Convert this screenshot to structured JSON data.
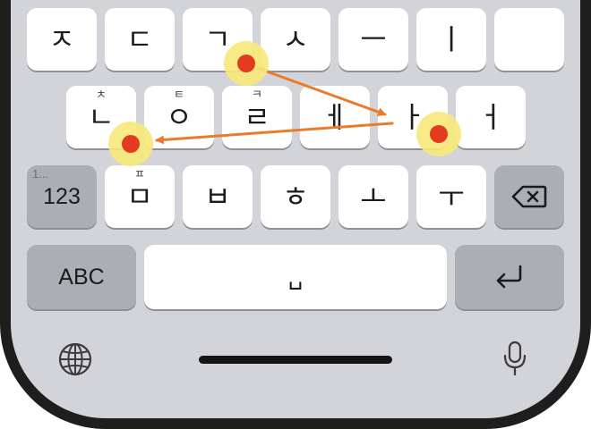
{
  "keyboard": {
    "row1": [
      {
        "char": "ㅈ"
      },
      {
        "char": "ㄷ"
      },
      {
        "char": "ㄱ"
      },
      {
        "char": "ㅅ"
      },
      {
        "char": "ㅡ"
      },
      {
        "char": "ㅣ"
      },
      {
        "char": ""
      }
    ],
    "row2": [
      {
        "char": "ㄴ",
        "sub": "ㅊ"
      },
      {
        "char": "ㅇ",
        "sub": "ㅌ"
      },
      {
        "char": "ㄹ",
        "sub": "ㅋ"
      },
      {
        "char": "ㅔ"
      },
      {
        "char": "ㅏ"
      },
      {
        "char": "ㅓ"
      }
    ],
    "row3": [
      {
        "char": "ㅁ",
        "sub": "ㅍ"
      },
      {
        "char": "ㅂ"
      },
      {
        "char": "ㅎ"
      },
      {
        "char": "ㅗ"
      },
      {
        "char": "ㅜ"
      }
    ],
    "numbers_key": {
      "label": "123",
      "hint": "1..."
    },
    "delete_key": {
      "icon": "backspace-icon"
    },
    "abc_key": {
      "label": "ABC"
    },
    "space_key": {
      "label": "␣"
    },
    "return_key": {
      "icon": "return-icon"
    },
    "globe_key": {
      "icon": "globe-icon"
    },
    "mic_key": {
      "icon": "microphone-icon"
    }
  },
  "swipe_path": {
    "points": [
      "ㄱ",
      "ㅏ",
      "ㄴ"
    ],
    "dot_color": "#e23b1f",
    "halo_color": "#f7e97a",
    "arrow_color": "#ec7a2c"
  },
  "colors": {
    "keyboard_bg": "#d3d4d9",
    "letter_key": "#ffffff",
    "function_key": "#abaeb5",
    "phone_frame": "#1e1e1e"
  }
}
